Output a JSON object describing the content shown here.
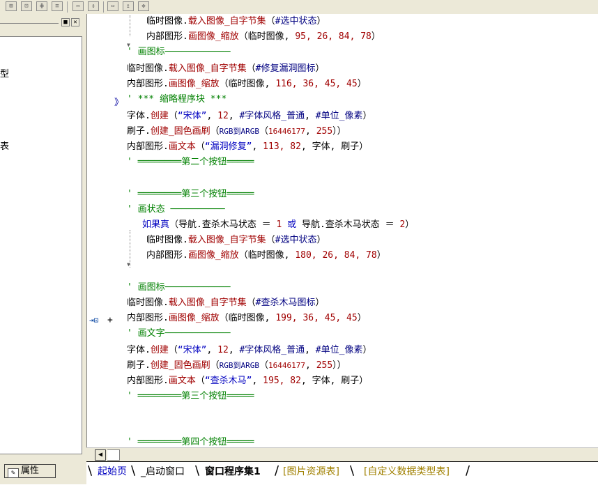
{
  "toolbar": {
    "icons": [
      "align-icon",
      "center-icon",
      "distribute-icon",
      "stack-icon",
      "width-icon",
      "height-icon",
      "resize-icon",
      "move-icon"
    ]
  },
  "left_panel": {
    "chars": [
      "型",
      "表"
    ],
    "properties_tab": "属性"
  },
  "code_lines": [
    {
      "parts": [
        {
          "t": "临时图像.",
          "c": "k"
        },
        {
          "t": "载入图像_自字节集",
          "c": "r"
        },
        {
          "t": "（",
          "c": "p"
        },
        {
          "t": "#选中状态",
          "c": "n"
        },
        {
          "t": "）",
          "c": "p"
        }
      ]
    },
    {
      "parts": [
        {
          "t": "内部图形.",
          "c": "k"
        },
        {
          "t": "画图像_缩放",
          "c": "r"
        },
        {
          "t": "（临时图像, ",
          "c": "p"
        },
        {
          "t": "95, 26, 84, 78",
          "c": "r"
        },
        {
          "t": "）",
          "c": "p"
        }
      ]
    },
    {
      "parts": [
        {
          "t": "' 画图标────────────",
          "c": "g"
        }
      ]
    },
    {
      "parts": [
        {
          "t": "临时图像.",
          "c": "k"
        },
        {
          "t": "载入图像_自字节集",
          "c": "r"
        },
        {
          "t": "（",
          "c": "p"
        },
        {
          "t": "#修复漏洞图标",
          "c": "n"
        },
        {
          "t": "）",
          "c": "p"
        }
      ]
    },
    {
      "parts": [
        {
          "t": "内部图形.",
          "c": "k"
        },
        {
          "t": "画图像_缩放",
          "c": "r"
        },
        {
          "t": "（临时图像, ",
          "c": "p"
        },
        {
          "t": "116, 36, 45, 45",
          "c": "r"
        },
        {
          "t": "）",
          "c": "p"
        }
      ]
    },
    {
      "parts": [
        {
          "t": "' *** 缩略程序块 ***",
          "c": "g"
        }
      ]
    },
    {
      "parts": [
        {
          "t": "字体.",
          "c": "k"
        },
        {
          "t": "创建",
          "c": "r"
        },
        {
          "t": "（",
          "c": "p"
        },
        {
          "t": "“宋体”",
          "c": "b"
        },
        {
          "t": ", ",
          "c": "p"
        },
        {
          "t": "12",
          "c": "r"
        },
        {
          "t": ", ",
          "c": "p"
        },
        {
          "t": "#字体风格_普通",
          "c": "n"
        },
        {
          "t": ", ",
          "c": "p"
        },
        {
          "t": "#单位_像素",
          "c": "n"
        },
        {
          "t": "）",
          "c": "p"
        }
      ]
    },
    {
      "parts": [
        {
          "t": "刷子.",
          "c": "k"
        },
        {
          "t": "创建_固色画刷",
          "c": "r"
        },
        {
          "t": "（",
          "c": "p"
        },
        {
          "t": "RGB到ARGB",
          "c": "n"
        },
        {
          "t": "（",
          "c": "p"
        },
        {
          "t": "16446177",
          "c": "r"
        },
        {
          "t": ", ",
          "c": "p"
        },
        {
          "t": "255",
          "c": "r"
        },
        {
          "t": "））",
          "c": "p"
        }
      ]
    },
    {
      "parts": [
        {
          "t": "内部图形.",
          "c": "k"
        },
        {
          "t": "画文本",
          "c": "r"
        },
        {
          "t": "（",
          "c": "p"
        },
        {
          "t": "“漏洞修复”",
          "c": "b"
        },
        {
          "t": ", ",
          "c": "p"
        },
        {
          "t": "113, 82",
          "c": "r"
        },
        {
          "t": ", 字体, 刷子）",
          "c": "p"
        }
      ]
    },
    {
      "parts": [
        {
          "t": "' ════════第二个按钮═════",
          "c": "g"
        }
      ]
    },
    {
      "parts": [
        {
          "t": "",
          "c": "p"
        }
      ]
    },
    {
      "parts": [
        {
          "t": "' ════════第三个按钮═════",
          "c": "g"
        }
      ]
    },
    {
      "parts": [
        {
          "t": "' 画状态 ──────────",
          "c": "g"
        }
      ]
    },
    {
      "parts": [
        {
          "t": "如果真",
          "c": "b"
        },
        {
          "t": "（导航.查杀木马状态 ＝ ",
          "c": "p"
        },
        {
          "t": "1",
          "c": "r"
        },
        {
          "t": " 或 ",
          "c": "b"
        },
        {
          "t": "导航.查杀木马状态 ＝ ",
          "c": "p"
        },
        {
          "t": "2",
          "c": "r"
        },
        {
          "t": "）",
          "c": "p"
        }
      ]
    },
    {
      "parts": [
        {
          "t": "临时图像.",
          "c": "k"
        },
        {
          "t": "载入图像_自字节集",
          "c": "r"
        },
        {
          "t": "（",
          "c": "p"
        },
        {
          "t": "#选中状态",
          "c": "n"
        },
        {
          "t": "）",
          "c": "p"
        }
      ]
    },
    {
      "parts": [
        {
          "t": "内部图形.",
          "c": "k"
        },
        {
          "t": "画图像_缩放",
          "c": "r"
        },
        {
          "t": "（临时图像, ",
          "c": "p"
        },
        {
          "t": "180, 26, 84, 78",
          "c": "r"
        },
        {
          "t": "）",
          "c": "p"
        }
      ]
    },
    {
      "parts": [
        {
          "t": "",
          "c": "p"
        }
      ]
    },
    {
      "parts": [
        {
          "t": "' 画图标────────────",
          "c": "g"
        }
      ]
    },
    {
      "parts": [
        {
          "t": "临时图像.",
          "c": "k"
        },
        {
          "t": "载入图像_自字节集",
          "c": "r"
        },
        {
          "t": "（",
          "c": "p"
        },
        {
          "t": "#查杀木马图标",
          "c": "n"
        },
        {
          "t": "）",
          "c": "p"
        }
      ]
    },
    {
      "parts": [
        {
          "t": "内部图形.",
          "c": "k"
        },
        {
          "t": "画图像_缩放",
          "c": "r"
        },
        {
          "t": "（临时图像, ",
          "c": "p"
        },
        {
          "t": "199, 36, 45, 45",
          "c": "r"
        },
        {
          "t": "）",
          "c": "p"
        }
      ]
    },
    {
      "parts": [
        {
          "t": "' 画文字────────────",
          "c": "g"
        }
      ]
    },
    {
      "parts": [
        {
          "t": "字体.",
          "c": "k"
        },
        {
          "t": "创建",
          "c": "r"
        },
        {
          "t": "（",
          "c": "p"
        },
        {
          "t": "“宋体”",
          "c": "b"
        },
        {
          "t": ", ",
          "c": "p"
        },
        {
          "t": "12",
          "c": "r"
        },
        {
          "t": ", ",
          "c": "p"
        },
        {
          "t": "#字体风格_普通",
          "c": "n"
        },
        {
          "t": ", ",
          "c": "p"
        },
        {
          "t": "#单位_像素",
          "c": "n"
        },
        {
          "t": "）",
          "c": "p"
        }
      ]
    },
    {
      "parts": [
        {
          "t": "刷子.",
          "c": "k"
        },
        {
          "t": "创建_固色画刷",
          "c": "r"
        },
        {
          "t": "（",
          "c": "p"
        },
        {
          "t": "RGB到ARGB",
          "c": "n"
        },
        {
          "t": "（",
          "c": "p"
        },
        {
          "t": "16446177",
          "c": "r"
        },
        {
          "t": ", ",
          "c": "p"
        },
        {
          "t": "255",
          "c": "r"
        },
        {
          "t": "））",
          "c": "p"
        }
      ]
    },
    {
      "parts": [
        {
          "t": "内部图形.",
          "c": "k"
        },
        {
          "t": "画文本",
          "c": "r"
        },
        {
          "t": "（",
          "c": "p"
        },
        {
          "t": "“查杀木马”",
          "c": "b"
        },
        {
          "t": ", ",
          "c": "p"
        },
        {
          "t": "195, 82",
          "c": "r"
        },
        {
          "t": ", 字体, 刷子）",
          "c": "p"
        }
      ]
    },
    {
      "parts": [
        {
          "t": "' ════════第三个按钮═════",
          "c": "g"
        }
      ]
    },
    {
      "parts": [
        {
          "t": "",
          "c": "p"
        }
      ]
    },
    {
      "parts": [
        {
          "t": "",
          "c": "p"
        }
      ]
    },
    {
      "parts": [
        {
          "t": "' ════════第四个按钮═════",
          "c": "g"
        }
      ]
    }
  ],
  "markers": {
    "fold": "》",
    "insert": "+"
  },
  "tabs": [
    {
      "label": "起始页",
      "color": "#0000c0",
      "bold": false
    },
    {
      "label": "_启动窗口",
      "color": "#000",
      "bold": false
    },
    {
      "label": "窗口程序集1",
      "color": "#000",
      "bold": true
    },
    {
      "label": "[图片资源表]",
      "color": "#a08000",
      "bold": false
    },
    {
      "label": "[自定义数据类型表]",
      "color": "#a08000",
      "bold": false
    }
  ]
}
